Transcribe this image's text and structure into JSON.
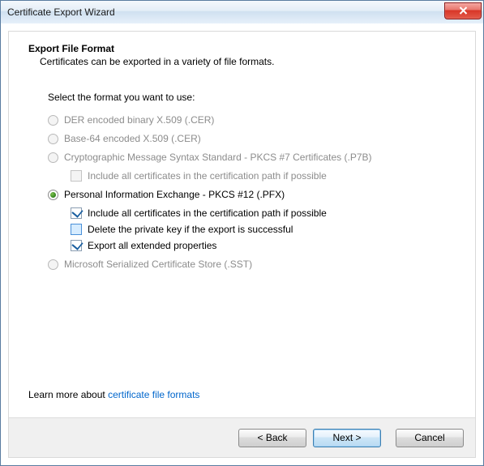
{
  "window": {
    "title": "Certificate Export Wizard"
  },
  "header": {
    "title": "Export File Format",
    "subtitle": "Certificates can be exported in a variety of file formats."
  },
  "prompt": "Select the format you want to use:",
  "options": {
    "der": {
      "label": "DER encoded binary X.509 (.CER)"
    },
    "base64": {
      "label": "Base-64 encoded X.509 (.CER)"
    },
    "p7b": {
      "label": "Cryptographic Message Syntax Standard - PKCS #7 Certificates (.P7B)",
      "include_path": "Include all certificates in the certification path if possible"
    },
    "pfx": {
      "label": "Personal Information Exchange - PKCS #12 (.PFX)",
      "include_path": "Include all certificates in the certification path if possible",
      "delete_key": "Delete the private key if the export is successful",
      "export_ext": "Export all extended properties"
    },
    "sst": {
      "label": "Microsoft Serialized Certificate Store (.SST)"
    }
  },
  "learn": {
    "prefix": "Learn more about ",
    "link": "certificate file formats"
  },
  "buttons": {
    "back": "< Back",
    "next": "Next >",
    "cancel": "Cancel"
  }
}
